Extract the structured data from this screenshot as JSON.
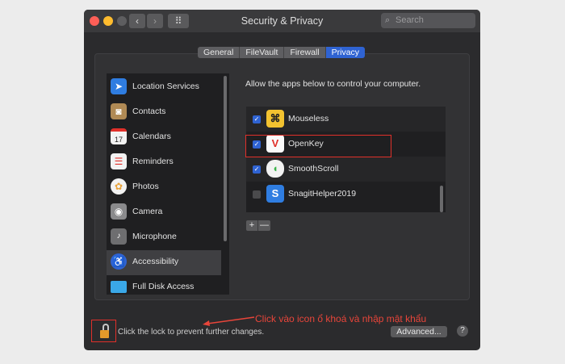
{
  "window": {
    "title": "Security & Privacy",
    "search_placeholder": "Search",
    "nav": {
      "back": "‹",
      "forward": "›",
      "grid": "⠿"
    }
  },
  "tabs": [
    {
      "label": "General",
      "active": false
    },
    {
      "label": "FileVault",
      "active": false
    },
    {
      "label": "Firewall",
      "active": false
    },
    {
      "label": "Privacy",
      "active": true
    }
  ],
  "sidebar": {
    "items": [
      {
        "label": "Location Services",
        "icon": "location-arrow-icon",
        "color": "#2f7de1",
        "glyph": "➤"
      },
      {
        "label": "Contacts",
        "icon": "contacts-book-icon",
        "color": "#b08a55",
        "glyph": "◙"
      },
      {
        "label": "Calendars",
        "icon": "calendar-icon",
        "color": "#f2f2f2",
        "glyph": "17"
      },
      {
        "label": "Reminders",
        "icon": "reminders-list-icon",
        "color": "#f2f2f2",
        "glyph": "☰"
      },
      {
        "label": "Photos",
        "icon": "photos-flower-icon",
        "color": "#e8a23a",
        "glyph": "✿"
      },
      {
        "label": "Camera",
        "icon": "camera-icon",
        "color": "#8a8a8c",
        "glyph": "◉"
      },
      {
        "label": "Microphone",
        "icon": "microphone-icon",
        "color": "#6e6e70",
        "glyph": "🎙"
      },
      {
        "label": "Accessibility",
        "icon": "accessibility-person-icon",
        "color": "#2f63d2",
        "glyph": "♿",
        "selected": true
      },
      {
        "label": "Full Disk Access",
        "icon": "folder-icon",
        "color": "#3aa8e8",
        "glyph": "▬"
      }
    ]
  },
  "privacy": {
    "instruction": "Allow the apps below to control your computer.",
    "apps": [
      {
        "label": "Mouseless",
        "checked": true,
        "icon": "mouseless-command-icon",
        "glyph": "⌘",
        "bg": "#f2c230",
        "fg": "#222"
      },
      {
        "label": "OpenKey",
        "checked": true,
        "icon": "openkey-v-icon",
        "glyph": "V",
        "bg": "#fafafa",
        "fg": "#e0302a"
      },
      {
        "label": "SmoothScroll",
        "checked": true,
        "icon": "smoothscroll-mouse-icon",
        "glyph": "◖",
        "bg": "#f2f2f2",
        "fg": "#3ab24a"
      },
      {
        "label": "SnagitHelper2019",
        "checked": false,
        "icon": "snagit-s-icon",
        "glyph": "S",
        "bg": "#2f7de1",
        "fg": "#fff"
      }
    ],
    "add": "+",
    "remove": "—"
  },
  "footer": {
    "lock_text": "Click the lock to prevent further changes.",
    "advanced": "Advanced...",
    "help": "?"
  },
  "annotation": "Click vào icon ổ khoá và nhập mật khẩu",
  "colors": {
    "accent": "#2f63d2",
    "annotation": "#e8453a"
  }
}
